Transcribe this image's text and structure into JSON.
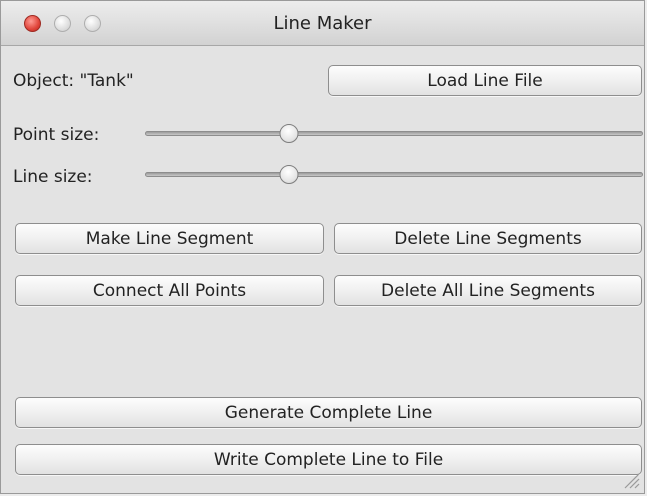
{
  "window": {
    "title": "Line Maker"
  },
  "object_label": "Object: \"Tank\"",
  "load_button": "Load Line File",
  "sliders": {
    "point_size": {
      "label": "Point size:",
      "value": 0.29
    },
    "line_size": {
      "label": "Line size:",
      "value": 0.29
    }
  },
  "buttons": {
    "make_segment": "Make Line Segment",
    "delete_segments": "Delete Line Segments",
    "connect_all": "Connect All Points",
    "delete_all": "Delete All Line Segments",
    "generate": "Generate Complete Line",
    "write_file": "Write Complete Line to File"
  },
  "icons": {
    "close": "close-icon",
    "minimize": "minimize-icon",
    "zoom": "zoom-icon",
    "resize": "resize-grip-icon"
  }
}
